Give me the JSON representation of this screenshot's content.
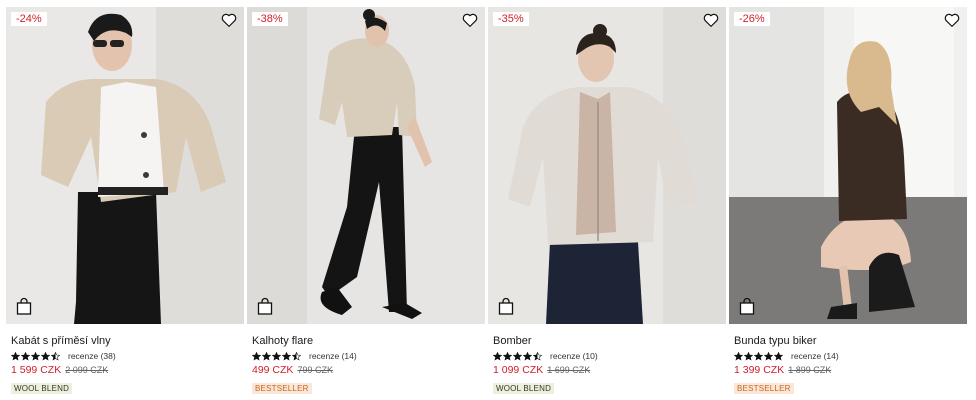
{
  "products": [
    {
      "discount": "-24%",
      "name": "Kabát s příměsí vlny",
      "rating": 4.5,
      "reviews": "recenze (38)",
      "price": "1 599 CZK",
      "old_price": "2 099 CZK",
      "tag": "WOOL BLEND",
      "tag_kind": "wool"
    },
    {
      "discount": "-38%",
      "name": "Kalhoty flare",
      "rating": 4.5,
      "reviews": "recenze (14)",
      "price": "499 CZK",
      "old_price": "799 CZK",
      "tag": "BESTSELLER",
      "tag_kind": "best"
    },
    {
      "discount": "-35%",
      "name": "Bomber",
      "rating": 4.5,
      "reviews": "recenze (10)",
      "price": "1 099 CZK",
      "old_price": "1 699 CZK",
      "tag": "WOOL BLEND",
      "tag_kind": "wool"
    },
    {
      "discount": "-26%",
      "name": "Bunda typu biker",
      "rating": 5,
      "reviews": "recenze (14)",
      "price": "1 399 CZK",
      "old_price": "1 899 CZK",
      "tag": "BESTSELLER",
      "tag_kind": "best"
    }
  ],
  "icons": {
    "wishlist": "heart-outline-icon",
    "add_to_bag": "shopping-bag-icon",
    "rating": "star-icon"
  },
  "colors": {
    "discount": "#d1202a",
    "price": "#d1202a",
    "wool_tag_bg": "#eef0df",
    "bestseller_tag_bg": "#fbe6d8",
    "bestseller_tag_text": "#c46a1f"
  }
}
